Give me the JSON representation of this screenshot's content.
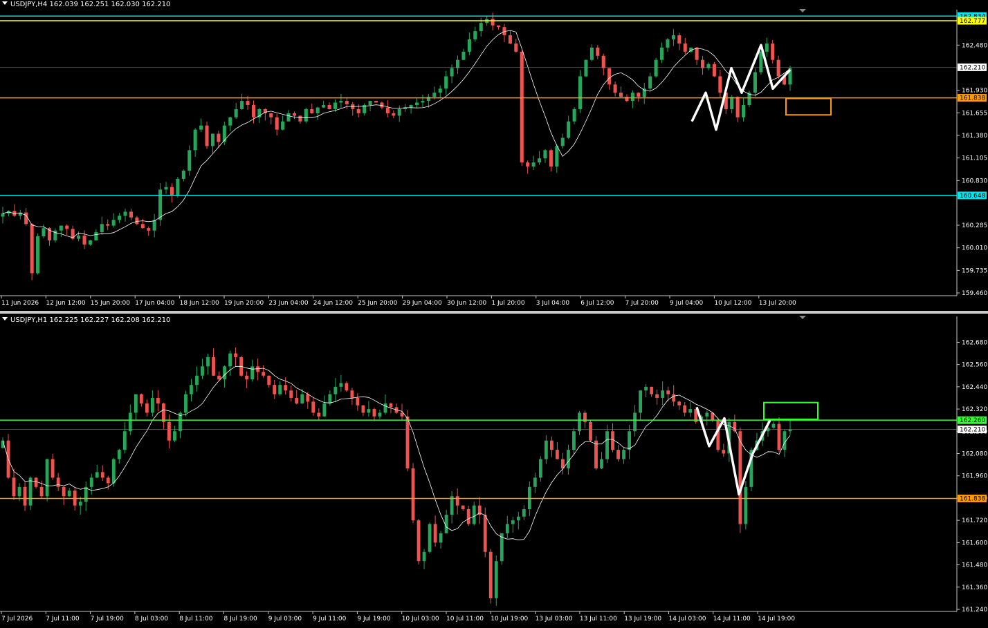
{
  "colors": {
    "background": "#000000",
    "bull": "#26a65b",
    "bear": "#ef5350",
    "ma": "#ffffff",
    "resistance": "#00e5ee",
    "yellow_line": "#ffff00",
    "orange_line": "#ff9a00",
    "green_line": "#32ff32",
    "axis_text": "#ffffff"
  },
  "chart_data": [
    {
      "type": "candlestick",
      "title": "USDJPY,H4  162.039 162.251 162.030 162.210",
      "symbol": "USDJPY",
      "timeframe": "H4",
      "ohlc_header": [
        "162.039",
        "162.251",
        "162.030",
        "162.210"
      ],
      "ylim": [
        159.46,
        162.87
      ],
      "yticks": [
        "162.480",
        "161.930",
        "161.655",
        "161.380",
        "161.105",
        "160.830",
        "160.285",
        "160.010",
        "159.735",
        "159.460"
      ],
      "xticks": [
        "11 Jun 2026",
        "12 Jun 12:00",
        "15 Jun 20:00",
        "17 Jun 04:00",
        "18 Jun 12:00",
        "19 Jun 20:00",
        "23 Jun 04:00",
        "24 Jun 12:00",
        "25 Jun 20:00",
        "29 Jun 04:00",
        "30 Jun 12:00",
        "1 Jul 20:00",
        "3 Jul 04:00",
        "6 Jul 12:00",
        "7 Jul 20:00",
        "9 Jul 04:00",
        "10 Jul 12:00",
        "13 Jul 20:00"
      ],
      "hlines": [
        {
          "label": "162.834",
          "value": 162.834,
          "color": "#00e5ee"
        },
        {
          "label": "162.777",
          "value": 162.777,
          "color": "#ffff00"
        },
        {
          "label": "161.838",
          "value": 161.838,
          "color": "#ff9a00"
        },
        {
          "label": "160.648",
          "value": 160.648,
          "color": "#00e5ee"
        }
      ],
      "current_price": {
        "label": "162.210",
        "value": 162.21
      },
      "closes": [
        160.43,
        160.46,
        160.4,
        160.44,
        160.3,
        159.7,
        160.15,
        160.25,
        160.1,
        160.22,
        160.28,
        160.24,
        160.12,
        160.16,
        160.05,
        160.1,
        160.2,
        160.3,
        160.28,
        160.35,
        160.4,
        160.45,
        160.38,
        160.3,
        160.25,
        160.22,
        160.35,
        160.72,
        160.75,
        160.65,
        160.85,
        160.95,
        161.2,
        161.45,
        161.5,
        161.25,
        161.4,
        161.3,
        161.5,
        161.6,
        161.7,
        161.8,
        161.75,
        161.6,
        161.7,
        161.65,
        161.6,
        161.45,
        161.55,
        161.65,
        161.62,
        161.55,
        161.7,
        161.65,
        161.72,
        161.75,
        161.7,
        161.78,
        161.8,
        161.76,
        161.7,
        161.65,
        161.75,
        161.8,
        161.78,
        161.72,
        161.65,
        161.62,
        161.7,
        161.72,
        161.75,
        161.78,
        161.8,
        161.85,
        161.9,
        161.95,
        162.1,
        162.2,
        162.3,
        162.4,
        162.55,
        162.65,
        162.75,
        162.8,
        162.72,
        162.7,
        162.6,
        162.5,
        162.4,
        161.05,
        161.0,
        161.05,
        161.1,
        161.2,
        161.0,
        161.25,
        161.35,
        161.55,
        161.7,
        162.1,
        162.3,
        162.45,
        162.35,
        162.2,
        162.0,
        161.9,
        161.85,
        161.8,
        161.9,
        161.85,
        161.95,
        162.1,
        162.3,
        162.45,
        162.55,
        162.6,
        162.5,
        162.4,
        162.45,
        162.3,
        162.2,
        162.25,
        162.1,
        161.9,
        161.7,
        161.85,
        161.6,
        161.75,
        161.9,
        162.15,
        162.4,
        162.5,
        162.3,
        162.1,
        162.0,
        162.2
      ]
    },
    {
      "type": "candlestick",
      "title": "USDJPY,H1  162.225 162.227 162.208 162.210",
      "symbol": "USDJPY",
      "timeframe": "H1",
      "ohlc_header": [
        "162.225",
        "162.227",
        "162.208",
        "162.210"
      ],
      "ylim": [
        161.24,
        162.73
      ],
      "yticks": [
        "162.680",
        "162.560",
        "162.440",
        "162.320",
        "162.200",
        "162.080",
        "161.960",
        "161.840",
        "161.720",
        "161.600",
        "161.480",
        "161.360",
        "161.240"
      ],
      "xticks": [
        "7 Jul 2026",
        "7 Jul 11:00",
        "7 Jul 19:00",
        "8 Jul 03:00",
        "8 Jul 11:00",
        "8 Jul 19:00",
        "9 Jul 03:00",
        "9 Jul 11:00",
        "9 Jul 19:00",
        "10 Jul 03:00",
        "10 Jul 11:00",
        "10 Jul 19:00",
        "13 Jul 03:00",
        "13 Jul 11:00",
        "13 Jul 19:00",
        "14 Jul 03:00",
        "14 Jul 11:00",
        "14 Jul 19:00"
      ],
      "hlines": [
        {
          "label": "162.260",
          "value": 162.26,
          "color": "#32ff32"
        },
        {
          "label": "161.838",
          "value": 161.838,
          "color": "#ff9a00"
        }
      ],
      "current_price": {
        "label": "162.210",
        "value": 162.21
      },
      "closes": [
        162.15,
        161.95,
        161.85,
        161.9,
        161.8,
        161.95,
        161.9,
        161.85,
        162.05,
        161.95,
        161.9,
        161.85,
        161.88,
        161.8,
        161.82,
        161.9,
        161.95,
        161.98,
        161.95,
        161.92,
        162.05,
        162.1,
        162.2,
        162.3,
        162.4,
        162.35,
        162.3,
        162.38,
        162.35,
        162.25,
        162.15,
        162.2,
        162.3,
        162.4,
        162.45,
        162.5,
        162.55,
        162.6,
        162.5,
        162.48,
        162.55,
        162.62,
        162.6,
        162.5,
        162.48,
        162.55,
        162.52,
        162.5,
        162.45,
        162.4,
        162.45,
        162.42,
        162.38,
        162.35,
        162.4,
        162.36,
        162.3,
        162.28,
        162.35,
        162.4,
        162.44,
        162.46,
        162.42,
        162.38,
        162.34,
        162.3,
        162.32,
        162.28,
        162.3,
        162.35,
        162.33,
        162.3,
        162.28,
        162.0,
        161.72,
        161.5,
        161.55,
        161.7,
        161.6,
        161.65,
        161.75,
        161.85,
        161.8,
        161.78,
        161.7,
        161.8,
        161.75,
        161.55,
        161.3,
        161.5,
        161.65,
        161.7,
        161.72,
        161.74,
        161.78,
        161.9,
        161.95,
        162.05,
        162.15,
        162.1,
        162.05,
        162.0,
        162.1,
        162.2,
        162.3,
        162.25,
        162.15,
        162.0,
        162.05,
        162.2,
        162.1,
        162.05,
        162.1,
        162.2,
        162.3,
        162.42,
        162.44,
        162.4,
        162.38,
        162.42,
        162.4,
        162.36,
        162.34,
        162.3,
        162.32,
        162.25,
        162.28,
        162.3,
        162.26,
        162.1,
        162.08,
        162.25,
        162.2,
        161.7,
        161.9,
        162.1,
        162.15,
        162.2,
        162.22,
        162.24,
        162.1,
        162.2,
        162.21
      ]
    }
  ]
}
